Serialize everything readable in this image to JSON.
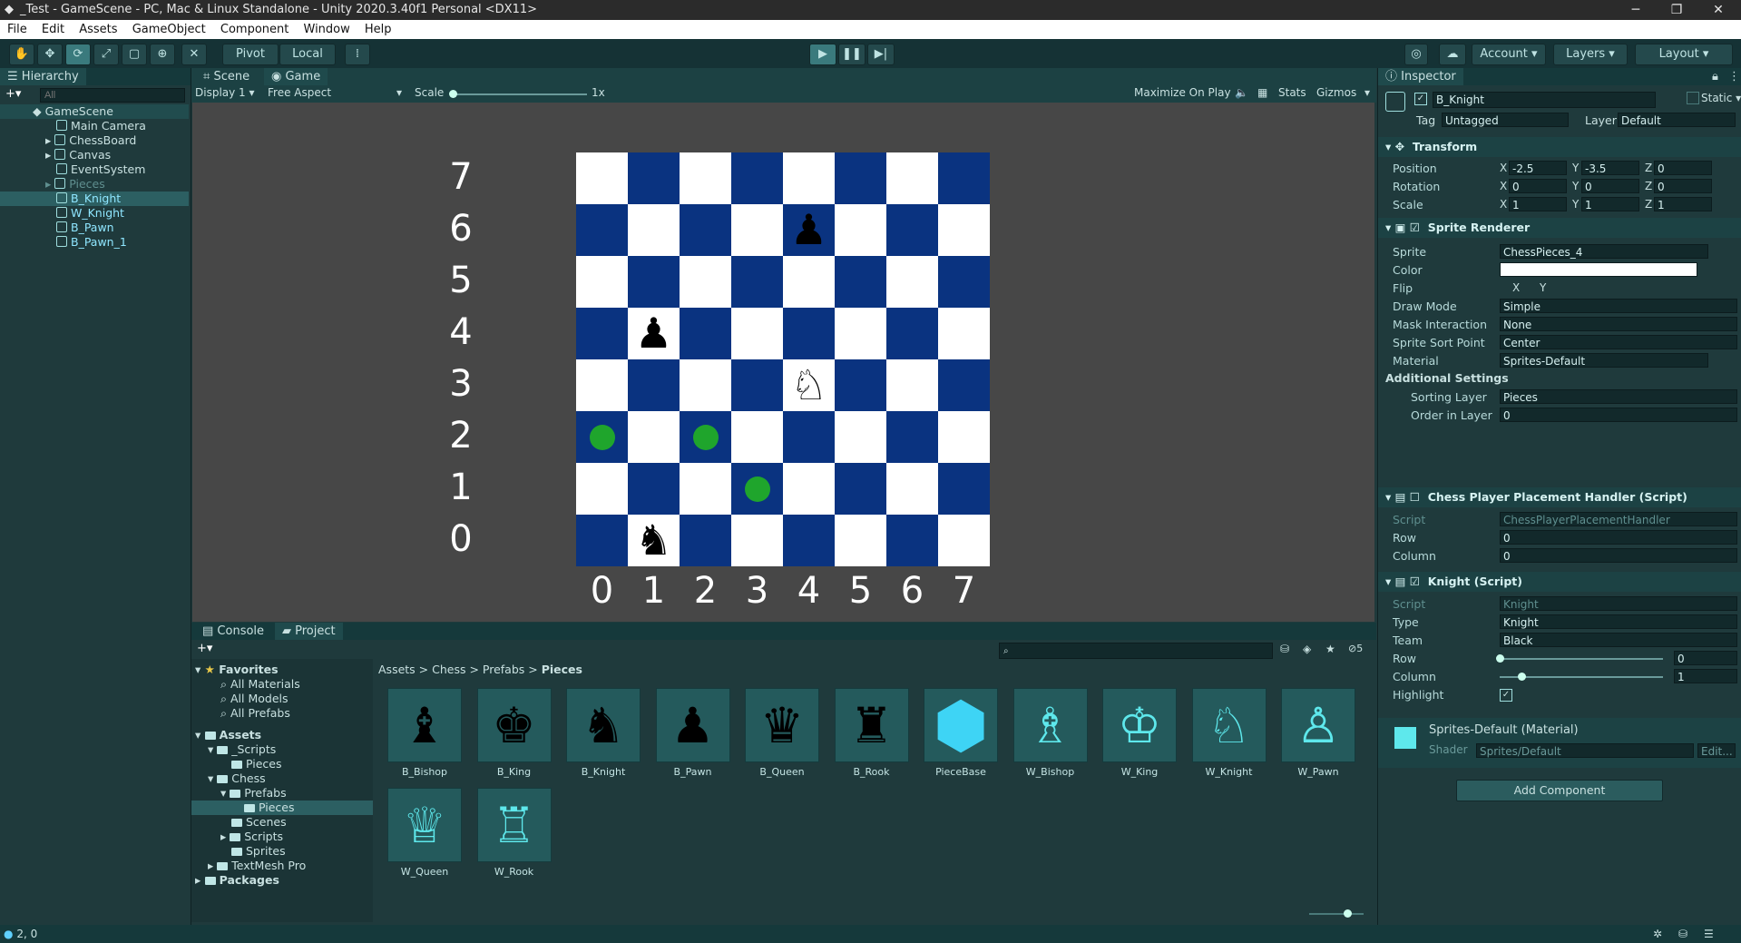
{
  "window": {
    "title": "_Test - GameScene - PC, Mac & Linux Standalone - Unity 2020.3.40f1 Personal <DX11>"
  },
  "menu": [
    "File",
    "Edit",
    "Assets",
    "GameObject",
    "Component",
    "Window",
    "Help"
  ],
  "toolbar": {
    "pivot": "Pivot",
    "local": "Local",
    "account": "Account",
    "layers": "Layers",
    "layout": "Layout"
  },
  "hierarchy": {
    "title": "Hierarchy",
    "search_placeholder": "All",
    "scene": "GameScene",
    "items": [
      "Main Camera",
      "ChessBoard",
      "Canvas",
      "EventSystem",
      "Pieces",
      "B_Knight",
      "W_Knight",
      "B_Pawn",
      "B_Pawn_1"
    ]
  },
  "gameview": {
    "tabs": [
      "Scene",
      "Game"
    ],
    "display": "Display 1",
    "aspect": "Free Aspect",
    "scale_label": "Scale",
    "scale_value": "1x",
    "maximize": "Maximize On Play",
    "stats": "Stats",
    "gizmos": "Gizmos",
    "row_labels": [
      "7",
      "6",
      "5",
      "4",
      "3",
      "2",
      "1",
      "0"
    ],
    "col_labels": [
      "0",
      "1",
      "2",
      "3",
      "4",
      "5",
      "6",
      "7"
    ],
    "colors": {
      "dark": "#0a3380",
      "light": "#ffffff",
      "dot": "#1fa52c"
    }
  },
  "board_pieces": [
    {
      "name": "b-pawn",
      "glyph": "♟",
      "row": 6,
      "col": 4,
      "color": "#000000"
    },
    {
      "name": "b-pawn",
      "glyph": "♟",
      "row": 4,
      "col": 1,
      "color": "#000000"
    },
    {
      "name": "w-knight",
      "glyph": "♘",
      "row": 3,
      "col": 4,
      "color": "#000000"
    },
    {
      "name": "b-knight",
      "glyph": "♞",
      "row": 0,
      "col": 1,
      "color": "#000000"
    }
  ],
  "board_dots": [
    {
      "row": 2,
      "col": 0
    },
    {
      "row": 2,
      "col": 2
    },
    {
      "row": 1,
      "col": 3
    }
  ],
  "bottom_tabs": [
    "Console",
    "Project"
  ],
  "project": {
    "favorites": {
      "title": "Favorites",
      "items": [
        "All Materials",
        "All Models",
        "All Prefabs"
      ]
    },
    "assets_title": "Assets",
    "tree": [
      "_Scripts",
      "Pieces",
      "Chess",
      "Prefabs",
      "Pieces",
      "Scenes",
      "Scripts",
      "Sprites",
      "TextMesh Pro"
    ],
    "packages": "Packages",
    "breadcrumb": [
      "Assets",
      "Chess",
      "Prefabs",
      "Pieces"
    ],
    "assets": [
      {
        "label": "B_Bishop",
        "glyph": "♝"
      },
      {
        "label": "B_King",
        "glyph": "♚"
      },
      {
        "label": "B_Knight",
        "glyph": "♞"
      },
      {
        "label": "B_Pawn",
        "glyph": "♟"
      },
      {
        "label": "B_Queen",
        "glyph": "♛"
      },
      {
        "label": "B_Rook",
        "glyph": "♜"
      },
      {
        "label": "PieceBase",
        "glyph": "⬢"
      },
      {
        "label": "W_Bishop",
        "glyph": "♗"
      },
      {
        "label": "W_King",
        "glyph": "♔"
      },
      {
        "label": "W_Knight",
        "glyph": "♘"
      },
      {
        "label": "W_Pawn",
        "glyph": "♙"
      },
      {
        "label": "W_Queen",
        "glyph": "♕"
      },
      {
        "label": "W_Rook",
        "glyph": "♖"
      }
    ],
    "count": "5"
  },
  "inspector": {
    "title": "Inspector",
    "object_name": "B_Knight",
    "static": "Static",
    "tag_label": "Tag",
    "tag": "Untagged",
    "layer_label": "Layer",
    "layer": "Default",
    "transform": {
      "title": "Transform",
      "position": {
        "label": "Position",
        "x": "-2.5",
        "y": "-3.5",
        "z": "0"
      },
      "rotation": {
        "label": "Rotation",
        "x": "0",
        "y": "0",
        "z": "0"
      },
      "scale": {
        "label": "Scale",
        "x": "1",
        "y": "1",
        "z": "1"
      }
    },
    "sprite_renderer": {
      "title": "Sprite Renderer",
      "sprite_label": "Sprite",
      "sprite": "ChessPieces_4",
      "color_label": "Color",
      "flip_label": "Flip",
      "flip_x": "X",
      "flip_y": "Y",
      "draw_mode_label": "Draw Mode",
      "draw_mode": "Simple",
      "mask_label": "Mask Interaction",
      "mask": "None",
      "sort_point_label": "Sprite Sort Point",
      "sort_point": "Center",
      "material_label": "Material",
      "material": "Sprites-Default",
      "additional": "Additional Settings",
      "sorting_layer_label": "Sorting Layer",
      "sorting_layer": "Pieces",
      "order_label": "Order in Layer",
      "order": "0"
    },
    "placement": {
      "title": "Chess Player Placement Handler (Script)",
      "script_label": "Script",
      "script": "ChessPlayerPlacementHandler",
      "row_label": "Row",
      "row": "0",
      "col_label": "Column",
      "col": "0"
    },
    "knight": {
      "title": "Knight (Script)",
      "script_label": "Script",
      "script": "Knight",
      "type_label": "Type",
      "type": "Knight",
      "team_label": "Team",
      "team": "Black",
      "row_label": "Row",
      "row": "0",
      "col_label": "Column",
      "col": "1",
      "highlight_label": "Highlight"
    },
    "material": {
      "title": "Sprites-Default (Material)",
      "shader_label": "Shader",
      "shader": "Sprites/Default",
      "edit": "Edit..."
    },
    "add_component": "Add Component"
  },
  "status": {
    "text": "2, 0"
  }
}
